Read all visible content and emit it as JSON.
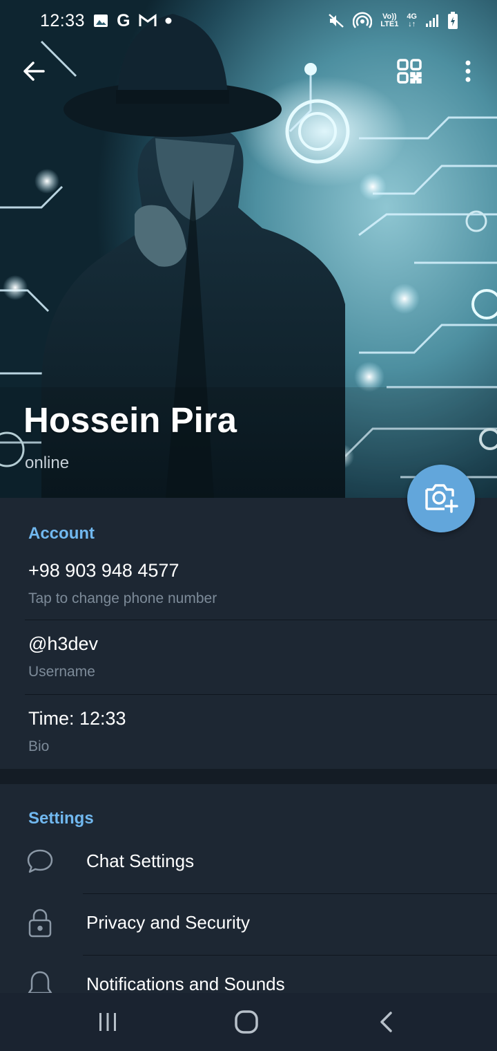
{
  "status_bar": {
    "time": "12:33",
    "left_icons": [
      "image-icon",
      "google-icon",
      "gmail-icon",
      "dot-icon"
    ],
    "right_icons": [
      "mute-icon",
      "hotspot-icon",
      "volte-icon",
      "4g-icon",
      "signal-icon",
      "battery-charging-icon"
    ],
    "volte_label_top": "Vo))",
    "volte_label_bottom": "LTE1",
    "network_label": "4G"
  },
  "toolbar": {
    "back_icon": "arrow-left-icon",
    "qr_icon": "qr-code-icon",
    "menu_icon": "more-vertical-icon"
  },
  "profile": {
    "name": "Hossein Pira",
    "status": "online"
  },
  "fab": {
    "icon": "camera-add-icon",
    "color": "#62a6db"
  },
  "account": {
    "title": "Account",
    "phone": {
      "value": "+98 903 948 4577",
      "label": "Tap to change phone number"
    },
    "username": {
      "value": "@h3dev",
      "label": "Username"
    },
    "bio": {
      "value": "Time: 12:33",
      "label": "Bio"
    }
  },
  "settings": {
    "title": "Settings",
    "items": [
      {
        "label": "Chat Settings",
        "icon": "chat-bubble-icon"
      },
      {
        "label": "Privacy and Security",
        "icon": "lock-icon"
      },
      {
        "label": "Notifications and Sounds",
        "icon": "bell-icon"
      }
    ]
  },
  "navbar": {
    "recents_icon": "recents-icon",
    "home_icon": "home-icon",
    "back_icon": "nav-back-icon"
  },
  "colors": {
    "background": "#1d2733",
    "accent": "#71b8ef",
    "secondary_text": "#7d8b99",
    "section_gap": "#141c25",
    "navbar": "#1a2330"
  }
}
